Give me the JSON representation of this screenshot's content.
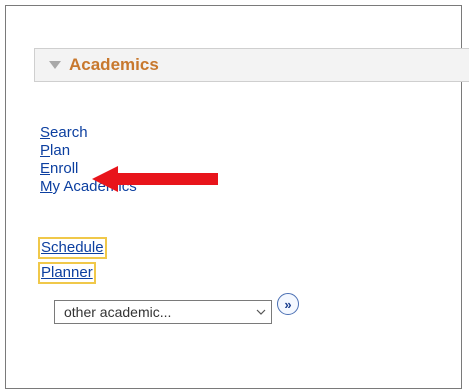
{
  "section": {
    "title": "Academics"
  },
  "links": [
    {
      "first": "S",
      "rest": "earch"
    },
    {
      "first": "P",
      "rest": "lan"
    },
    {
      "first": "E",
      "rest": "nroll"
    },
    {
      "first": "M",
      "rest": "y Academics"
    }
  ],
  "quick_links": {
    "schedule": "Schedule",
    "planner": "Planner"
  },
  "dropdown": {
    "selected": "other academic...",
    "go_glyph": "»"
  },
  "colors": {
    "section_title": "#c8782d",
    "link": "#0c3fa0",
    "highlight_border": "#f0c84a",
    "arrow": "#e8141b"
  },
  "icons": {
    "collapse": "triangle-down-icon",
    "annotation": "red-arrow-icon",
    "dropdown": "chevron-down-icon",
    "go": "double-chevron-right-icon"
  }
}
